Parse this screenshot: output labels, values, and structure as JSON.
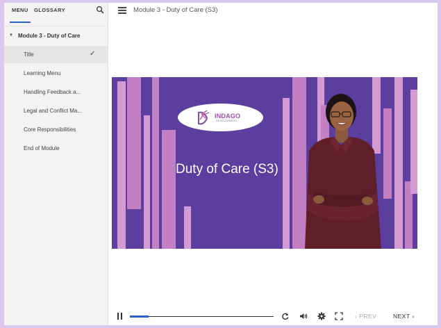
{
  "sidebar": {
    "tabs": [
      {
        "label": "MENU"
      },
      {
        "label": "GLOSSARY"
      }
    ],
    "module": {
      "title": "Module 3 - Duty of Care"
    },
    "items": [
      {
        "label": "Title",
        "completed": true
      },
      {
        "label": "Learning Menu"
      },
      {
        "label": "Handling Feedback a..."
      },
      {
        "label": "Legal and Conflict Ma..."
      },
      {
        "label": "Core Responsibilities"
      },
      {
        "label": "End of Module"
      }
    ]
  },
  "header": {
    "title": "Module 3 - Duty of Care (S3)"
  },
  "slide": {
    "title": "Duty of Care (S3)",
    "logo": {
      "name": "INDAGO",
      "tagline": "DEVELOPMENT"
    },
    "colors": {
      "background": "#5b3e9e",
      "bars": "#c27fc3"
    }
  },
  "player": {
    "progress": 0.13,
    "prev_label": "PREV",
    "next_label": "NEXT",
    "icons": [
      "pause-icon",
      "replay-icon",
      "volume-icon",
      "settings-icon",
      "fullscreen-icon"
    ]
  },
  "colors": {
    "accent": "#2a5fd6",
    "page_border": "#dcc8ef"
  }
}
